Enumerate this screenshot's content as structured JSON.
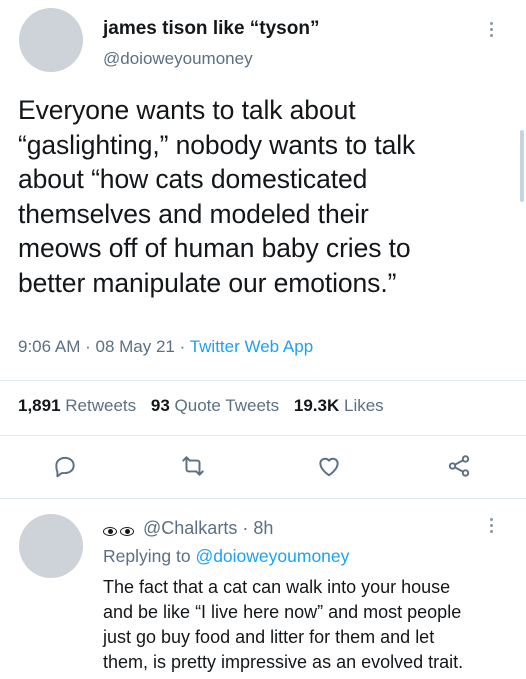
{
  "tweet": {
    "display_name": "james tison like “tyson”",
    "handle": "@doioweyoumoney",
    "text_lines": [
      "Everyone wants to talk about",
      "“gaslighting,” nobody wants to talk",
      "about “how cats domesticated",
      "themselves and modeled their",
      "meows off of human baby cries to",
      "better manipulate our emotions.”"
    ],
    "time": "9:06 AM",
    "date": "08 May 21",
    "source": "Twitter Web App",
    "retweets_count": "1,891",
    "retweets_label": "Retweets",
    "quotes_count": "93",
    "quotes_label": "Quote Tweets",
    "likes_count": "19.3K",
    "likes_label": "Likes"
  },
  "actions": {
    "icons": [
      "reply-icon",
      "retweet-icon",
      "like-icon",
      "share-icon"
    ]
  },
  "reply": {
    "emoji": "eyes-emoji",
    "handle": "@Chalkarts",
    "time": "8h",
    "replying_prefix": "Replying to",
    "replying_to": "@doioweyoumoney",
    "text_lines": [
      "The fact that a cat can walk into your house",
      "and be like “I live here now” and most people",
      "just go buy food and litter for them and let",
      "them, is pretty impressive as an evolved trait."
    ]
  },
  "colors": {
    "accent": "#1da1f2",
    "secondary_text": "#5b7083",
    "primary_text": "#14171a",
    "divider": "#e1e8ed"
  }
}
